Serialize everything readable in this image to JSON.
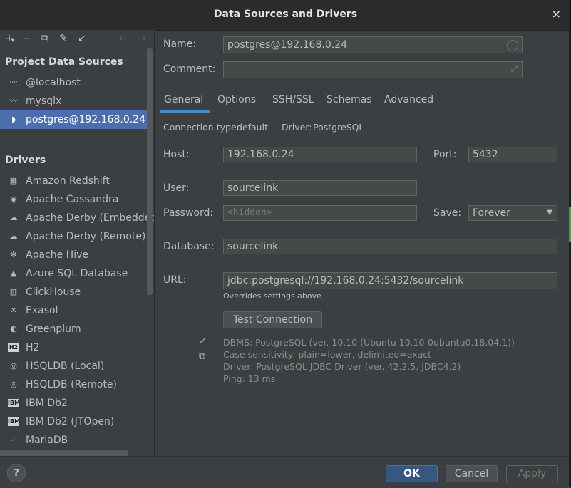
{
  "window": {
    "title": "Data Sources and Drivers",
    "close_glyph": "×"
  },
  "toolbar": {
    "add": "+",
    "add_menu": "▾",
    "remove": "−",
    "copy": "⧉",
    "settings": "✎",
    "import": "↙",
    "back": "←",
    "forward": "→"
  },
  "project_data_sources": {
    "title": "Project Data Sources",
    "items": [
      {
        "label": "@localhost",
        "icon": "dolphin-icon"
      },
      {
        "label": "mysqlx",
        "icon": "dolphin-icon"
      },
      {
        "label": "postgres@192.168.0.24",
        "icon": "elephant-icon",
        "selected": true
      }
    ]
  },
  "drivers": {
    "title": "Drivers",
    "items": [
      {
        "label": "Amazon Redshift",
        "icon": "redshift-icon",
        "glyph": "▦"
      },
      {
        "label": "Apache Cassandra",
        "icon": "eye-icon",
        "glyph": "◉"
      },
      {
        "label": "Apache Derby (Embedded)",
        "icon": "hat-icon",
        "glyph": "☁"
      },
      {
        "label": "Apache Derby (Remote)",
        "icon": "hat-icon",
        "glyph": "☁"
      },
      {
        "label": "Apache Hive",
        "icon": "bee-icon",
        "glyph": "✻"
      },
      {
        "label": "Azure SQL Database",
        "icon": "azure-icon",
        "glyph": "▲"
      },
      {
        "label": "ClickHouse",
        "icon": "bars-icon",
        "glyph": "▥"
      },
      {
        "label": "Exasol",
        "icon": "x-icon",
        "glyph": "✕"
      },
      {
        "label": "Greenplum",
        "icon": "circle-icon",
        "glyph": "◐"
      },
      {
        "label": "H2",
        "icon": "h2-icon",
        "glyph": "H2",
        "badge": true
      },
      {
        "label": "HSQLDB (Local)",
        "icon": "hsqldb-icon",
        "glyph": "◎"
      },
      {
        "label": "HSQLDB (Remote)",
        "icon": "hsqldb-icon",
        "glyph": "◎"
      },
      {
        "label": "IBM Db2",
        "icon": "ibm-icon",
        "glyph": "IBM",
        "badge": true
      },
      {
        "label": "IBM Db2 (JTOpen)",
        "icon": "ibm-icon",
        "glyph": "IBM",
        "badge": true
      },
      {
        "label": "MariaDB",
        "icon": "seal-icon",
        "glyph": "∽"
      }
    ]
  },
  "form": {
    "name_label": "Name:",
    "name_value": "postgres@192.168.0.24",
    "comment_label": "Comment:",
    "comment_value": "",
    "tabs": [
      "General",
      "Options",
      "SSH/SSL",
      "Schemas",
      "Advanced"
    ],
    "active_tab": "General",
    "connection_type_label": "Connection type:",
    "connection_type_value": "default",
    "driver_label": "Driver:",
    "driver_value": "PostgreSQL",
    "host_label": "Host:",
    "host_value": "192.168.0.24",
    "port_label": "Port:",
    "port_value": "5432",
    "user_label": "User:",
    "user_value": "sourcelink",
    "password_label": "Password:",
    "password_placeholder": "<hidden>",
    "save_label": "Save:",
    "save_value": "Forever",
    "database_label": "Database:",
    "database_value": "sourcelink",
    "url_label": "URL:",
    "url_value": "jdbc:postgresql://192.168.0.24:5432/sourcelink",
    "url_note": "Overrides settings above",
    "test_button": "Test Connection",
    "test_status_glyph": "✔",
    "copy_glyph": "⧉",
    "result_lines": [
      "DBMS: PostgreSQL (ver. 10.10 (Ubuntu 10.10-0ubuntu0.18.04.1))",
      "Case sensitivity: plain=lower, delimited=exact",
      "Driver: PostgreSQL JDBC Driver (ver. 42.2.5, JDBC4.2)",
      "Ping: 13 ms"
    ]
  },
  "footer": {
    "help": "?",
    "ok": "OK",
    "cancel": "Cancel",
    "apply": "Apply"
  },
  "colors": {
    "accent": "#4b6eaf",
    "link": "#589df6",
    "success": "#59a869"
  }
}
